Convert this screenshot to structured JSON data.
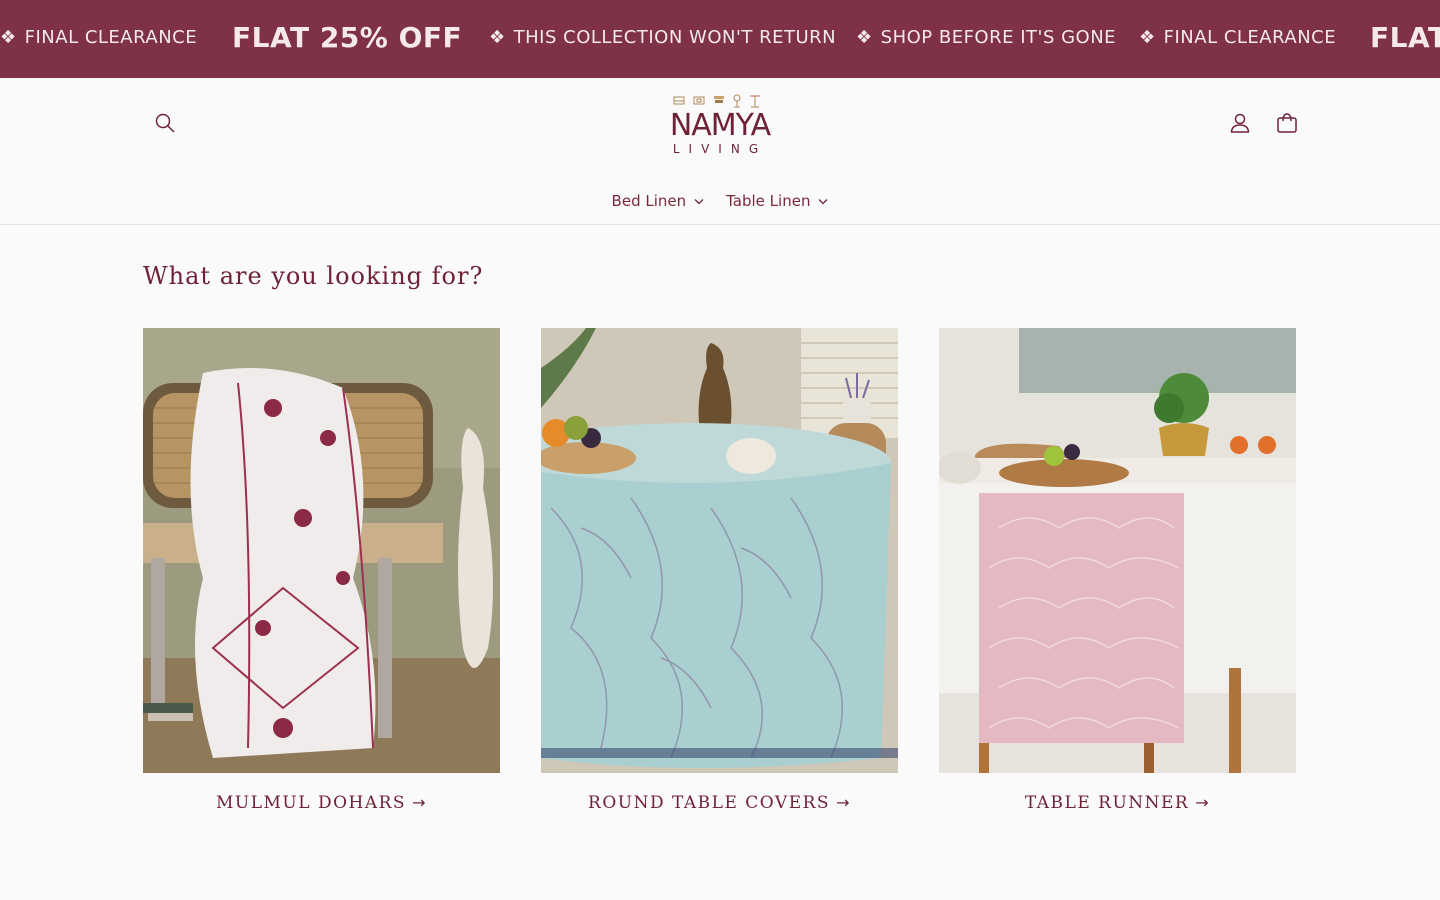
{
  "announcement": {
    "items": [
      {
        "symbol": "❖",
        "text": "FINAL CLEARANCE",
        "style": "small"
      },
      {
        "symbol": "",
        "text": "FLAT 25% OFF",
        "style": "big"
      },
      {
        "symbol": "❖",
        "text": "THIS COLLECTION WON'T RETURN",
        "style": "small"
      },
      {
        "symbol": "❖",
        "text": "SHOP BEFORE IT'S GONE",
        "style": "small"
      },
      {
        "symbol": "❖",
        "text": "FINAL CLEARANCE",
        "style": "small"
      },
      {
        "symbol": "",
        "text": "FLAT",
        "style": "big"
      }
    ]
  },
  "header": {
    "logo": {
      "line1": "NAMYA",
      "line2": "LIVING"
    },
    "icons": {
      "search": "search-icon",
      "account": "user-icon",
      "cart": "bag-icon"
    }
  },
  "nav": {
    "items": [
      {
        "label": "Bed Linen",
        "icon": "chevron-down-icon"
      },
      {
        "label": "Table Linen",
        "icon": "chevron-down-icon"
      }
    ]
  },
  "collections": {
    "heading": "What are you looking for?",
    "cards": [
      {
        "label": "MULMUL DOHARS",
        "arrow": "→"
      },
      {
        "label": "ROUND TABLE COVERS",
        "arrow": "→"
      },
      {
        "label": "TABLE RUNNER",
        "arrow": "→"
      }
    ]
  },
  "colors": {
    "brand": "#7f3147",
    "text": "#6f2236",
    "background": "#fafafa"
  }
}
